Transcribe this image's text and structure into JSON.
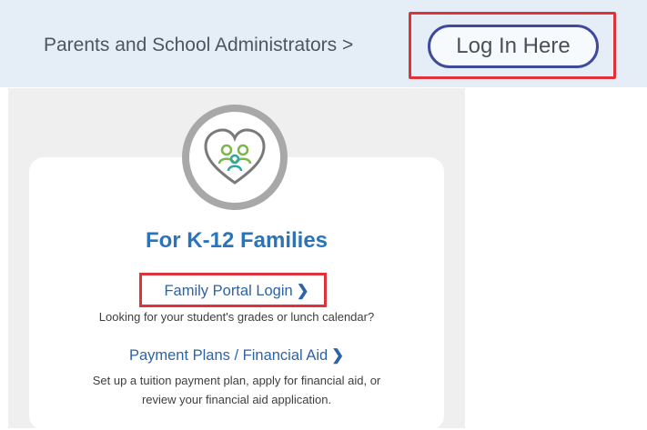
{
  "topbar": {
    "parents_text": "Parents and School Administrators >",
    "login_label": "Log In Here"
  },
  "families_card": {
    "title": "For K-12 Families",
    "family_portal_link": "Family Portal Login",
    "family_portal_desc": "Looking for your student's grades or lunch calendar?",
    "payment_link": "Payment Plans / Financial Aid",
    "payment_desc_line1": "Set up a tuition payment plan, apply for financial aid, or",
    "payment_desc_line2": "review your financial aid application.",
    "chevron": "❯"
  },
  "icons": {
    "family_icon": "heart-family-icon",
    "chevron_icon": "chevron-right-icon"
  },
  "colors": {
    "highlight": "#e0323b",
    "title_blue": "#2b74b9",
    "link_blue": "#2d63a6",
    "login_border": "#3f4a9c",
    "heart_green": "#7ab648",
    "figure_teal": "#2fa6a0"
  }
}
